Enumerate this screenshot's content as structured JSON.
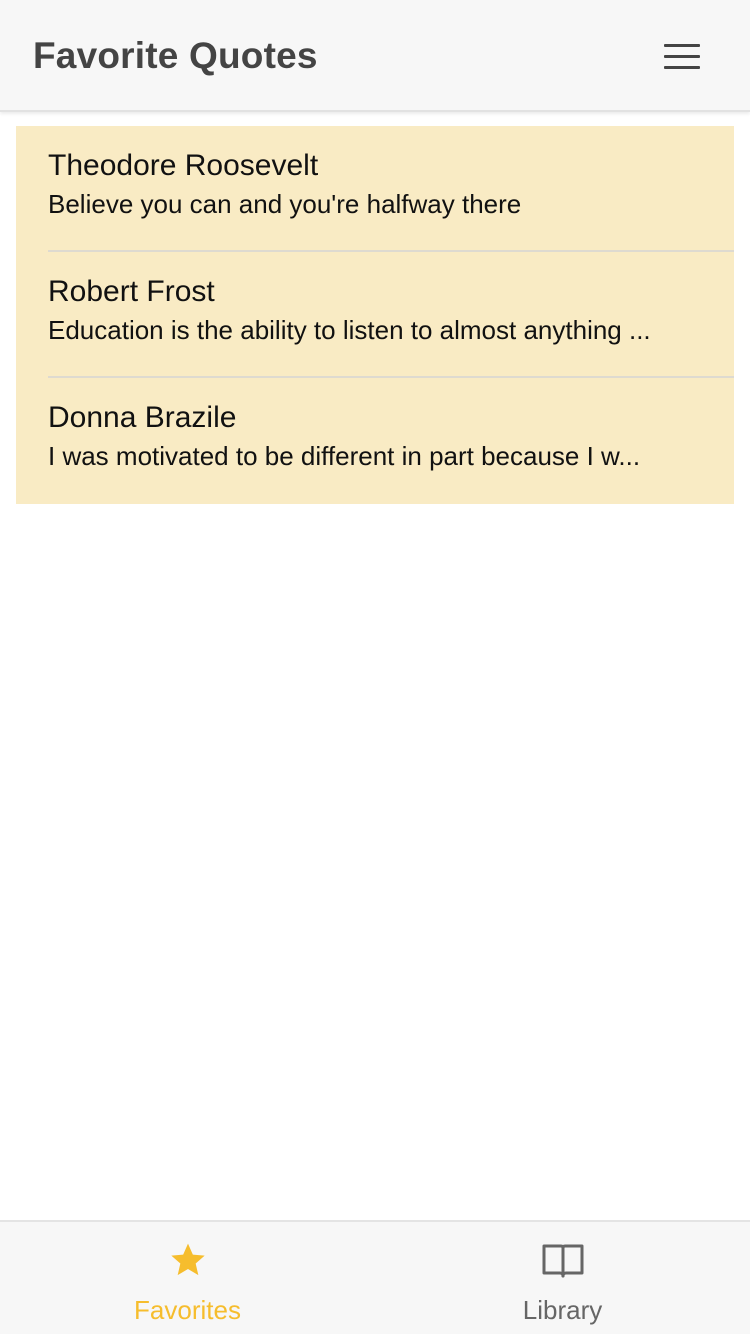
{
  "header": {
    "title": "Favorite Quotes",
    "menu_icon": "hamburger-menu-icon"
  },
  "quotes": [
    {
      "author": "Theodore Roosevelt",
      "text": "Believe you can and you're halfway there"
    },
    {
      "author": "Robert Frost",
      "text": "Education is the ability to listen to almost anything ..."
    },
    {
      "author": "Donna Brazile",
      "text": "I was motivated to be different in part because I w..."
    }
  ],
  "tabs": [
    {
      "label": "Favorites",
      "icon": "star-icon",
      "active": true
    },
    {
      "label": "Library",
      "icon": "book-icon",
      "active": false
    }
  ],
  "colors": {
    "accent": "#f6bd2d",
    "list_background": "#f9ebc4",
    "header_background": "#f7f7f7"
  }
}
